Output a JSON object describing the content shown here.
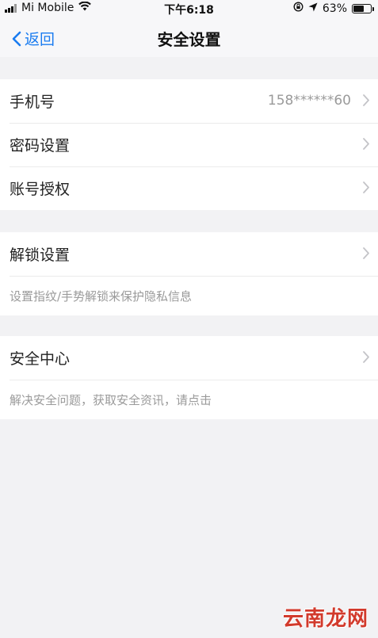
{
  "status_bar": {
    "carrier": "Mi Mobile",
    "time": "下午6:18",
    "battery_percent": "63%",
    "battery_level": 0.63
  },
  "nav": {
    "back_label": "返回",
    "title": "安全设置"
  },
  "sections": [
    {
      "rows": [
        {
          "label": "手机号",
          "value": "158******60"
        },
        {
          "label": "密码设置"
        },
        {
          "label": "账号授权"
        }
      ]
    },
    {
      "rows": [
        {
          "label": "解锁设置"
        }
      ],
      "hint": "设置指纹/手势解锁来保护隐私信息"
    },
    {
      "rows": [
        {
          "label": "安全中心"
        }
      ],
      "hint": "解决安全问题，获取安全资讯，请点击"
    }
  ],
  "watermark": "云南龙网",
  "colors": {
    "accent": "#1a7cf0",
    "background": "#f2f2f4",
    "secondary_text": "#9a9a9a"
  }
}
